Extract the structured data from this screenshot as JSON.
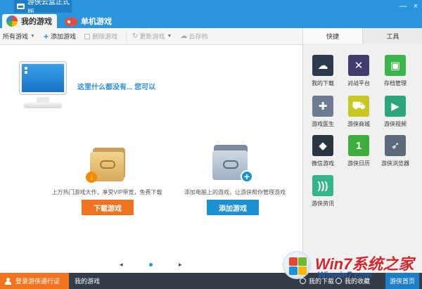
{
  "window": {
    "title": "游侠云盒正式版",
    "controls": [
      "—",
      "×"
    ]
  },
  "tabs": [
    {
      "label": "我的游戏"
    },
    {
      "label": "单机游戏"
    }
  ],
  "toolbar": {
    "all_games": "所有游戏",
    "add_game": "添加游戏",
    "delete_game": "删除游戏",
    "update_game": "更新游戏",
    "cloud_save": "云存档"
  },
  "empty_state": {
    "message": "这里什么都没有... 您可以"
  },
  "cards": [
    {
      "text": "上万热门游戏大作，享受VIP带宽，免费下载",
      "button": "下载游戏",
      "badge": "↓"
    },
    {
      "text": "添加电脑上的游戏，让游侠帮你管理游戏",
      "button": "添加游戏",
      "badge": "+"
    }
  ],
  "pager": {
    "prev": "◂",
    "next": "▸"
  },
  "right_panel": {
    "tabs": [
      "快捷",
      "工具"
    ],
    "tiles": [
      {
        "label": "我的下载",
        "icon": "cloud-download-icon",
        "color": "#2d3a4d",
        "glyph": "☁"
      },
      {
        "label": "对战平台",
        "icon": "crossed-swords-icon",
        "color": "#3f3d6e",
        "glyph": "✕"
      },
      {
        "label": "存档管理",
        "icon": "gamepad-icon",
        "color": "#3cb54a",
        "glyph": "▣"
      },
      {
        "label": "游戏医生",
        "icon": "medical-cross-icon",
        "color": "#6d7c92",
        "glyph": "✚"
      },
      {
        "label": "游侠商城",
        "icon": "shopping-cart-icon",
        "color": "#c9c722",
        "glyph": "⛟"
      },
      {
        "label": "游侠视频",
        "icon": "video-chat-icon",
        "color": "#2aa67a",
        "glyph": "▶"
      },
      {
        "label": "微信游戏",
        "icon": "puzzle-icon",
        "color": "#2b3542",
        "glyph": "◆"
      },
      {
        "label": "游侠日历",
        "icon": "calendar-icon",
        "color": "#3cae3c",
        "glyph": "1"
      },
      {
        "label": "游侠浏览器",
        "icon": "rocket-icon",
        "color": "#5c6a7c",
        "glyph": "➶"
      },
      {
        "label": "游侠资讯",
        "icon": "rss-icon",
        "color": "#33b48a",
        "glyph": ")))"
      }
    ]
  },
  "bottom_bar": {
    "login": "登录游侠通行证",
    "my_games": "我的游戏",
    "downloads": "我的下载",
    "favorites": "我的收藏",
    "home": "游侠首页"
  },
  "watermark": {
    "brand": "Win7系统之家",
    "sub": "Winwin7.com"
  }
}
